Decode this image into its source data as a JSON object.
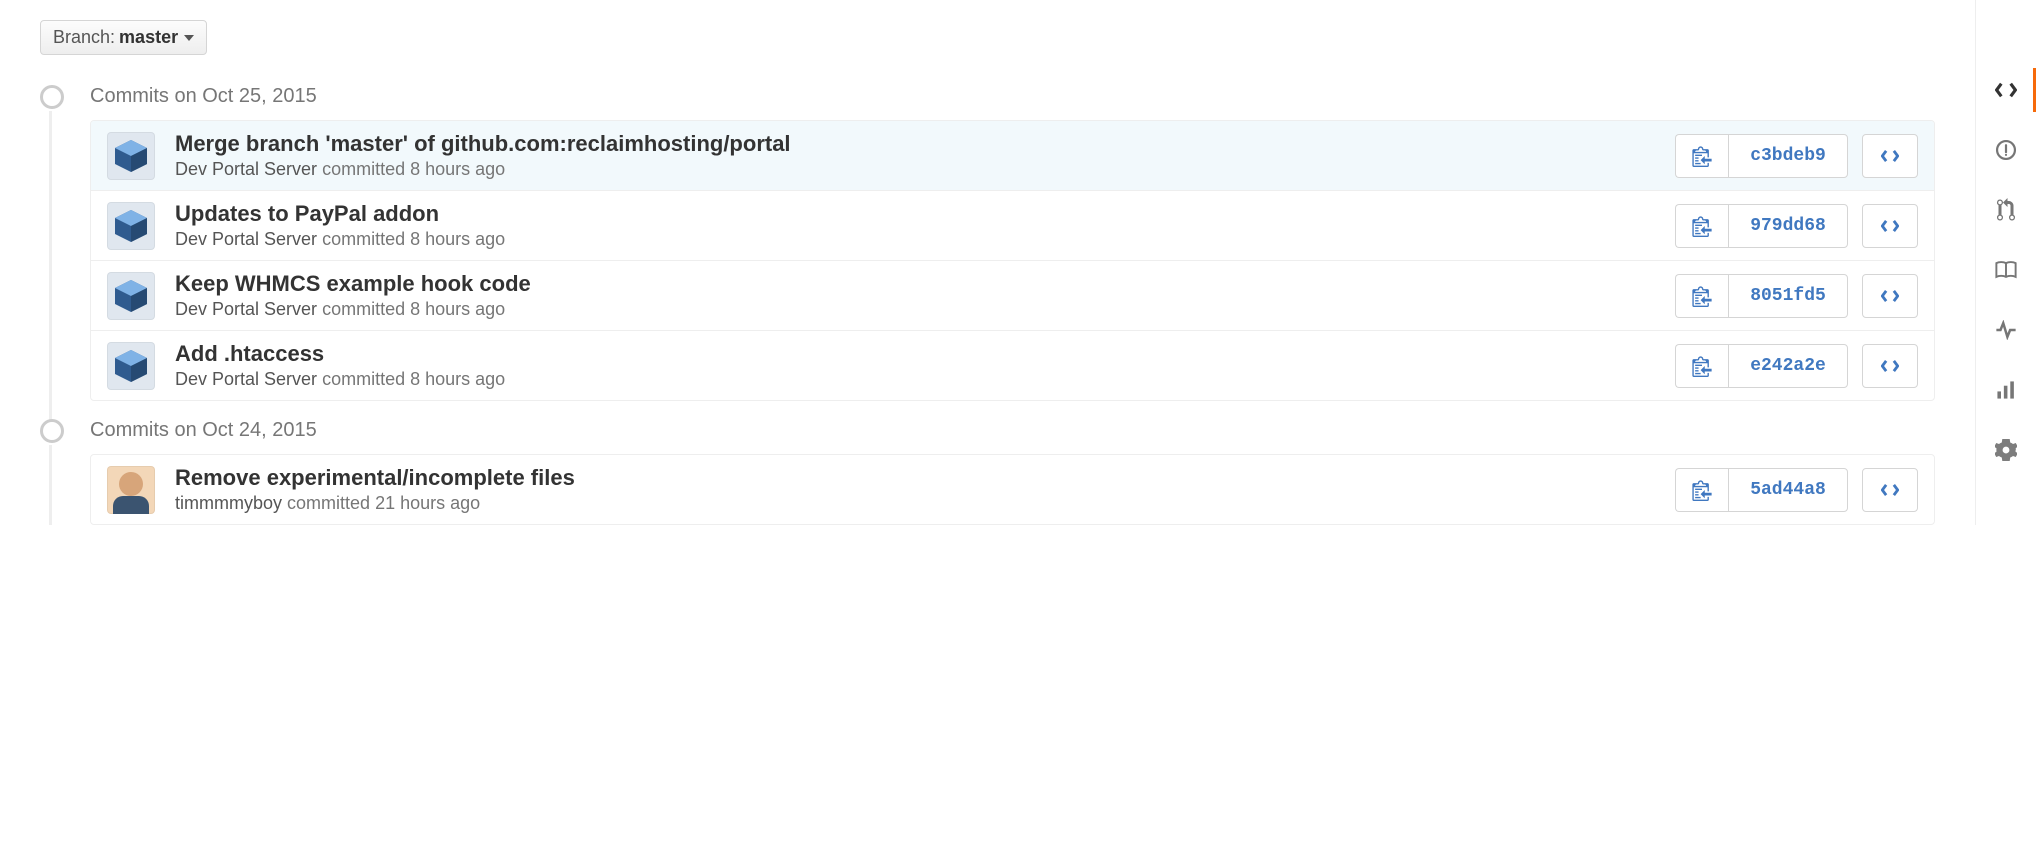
{
  "branch": {
    "label": "Branch:",
    "name": "master"
  },
  "groups": [
    {
      "title": "Commits on Oct 25, 2015",
      "commits": [
        {
          "highlight": true,
          "avatar": "box",
          "title": "Merge branch 'master' of github.com:reclaimhosting/portal",
          "author": "Dev Portal Server",
          "when": "8 hours ago",
          "sha": "c3bdeb9"
        },
        {
          "highlight": false,
          "avatar": "box",
          "title": "Updates to PayPal addon",
          "author": "Dev Portal Server",
          "when": "8 hours ago",
          "sha": "979dd68"
        },
        {
          "highlight": false,
          "avatar": "box",
          "title": "Keep WHMCS example hook code",
          "author": "Dev Portal Server",
          "when": "8 hours ago",
          "sha": "8051fd5"
        },
        {
          "highlight": false,
          "avatar": "box",
          "title": "Add .htaccess",
          "author": "Dev Portal Server",
          "when": "8 hours ago",
          "sha": "e242a2e"
        }
      ]
    },
    {
      "title": "Commits on Oct 24, 2015",
      "commits": [
        {
          "highlight": false,
          "avatar": "user",
          "title": "Remove experimental/incomplete files",
          "author": "timmmmyboy",
          "when": "21 hours ago",
          "sha": "5ad44a8"
        }
      ]
    }
  ],
  "meta_word": "committed",
  "right_tabs": [
    "code",
    "issues",
    "pulls",
    "wiki",
    "pulse",
    "graphs",
    "settings"
  ],
  "right_active": "code"
}
